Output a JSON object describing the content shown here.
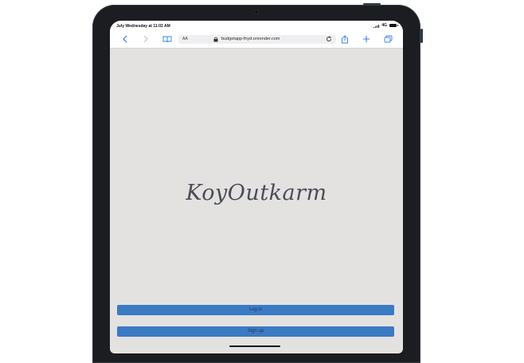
{
  "status_bar": {
    "time": "July Wednesday at 11:02 AM",
    "network": "4G"
  },
  "browser": {
    "text_size_label": "AA",
    "url": "budgetapp-fnyd.onrender.com",
    "icons": [
      "back-icon",
      "forward-icon",
      "bookmarks-icon",
      "lock-icon",
      "reload-icon",
      "share-icon",
      "new-tab-icon",
      "tabs-icon"
    ]
  },
  "page": {
    "logo_text": "KoyOutkarm",
    "login_label": "Log in",
    "signup_label": "Sign up"
  },
  "colors": {
    "page_background": "#e4e2e1",
    "button": "#3b7bc4",
    "button_text": "#23364f",
    "browser_accent": "#2f7df6",
    "logo_text": "#4a4d55"
  }
}
